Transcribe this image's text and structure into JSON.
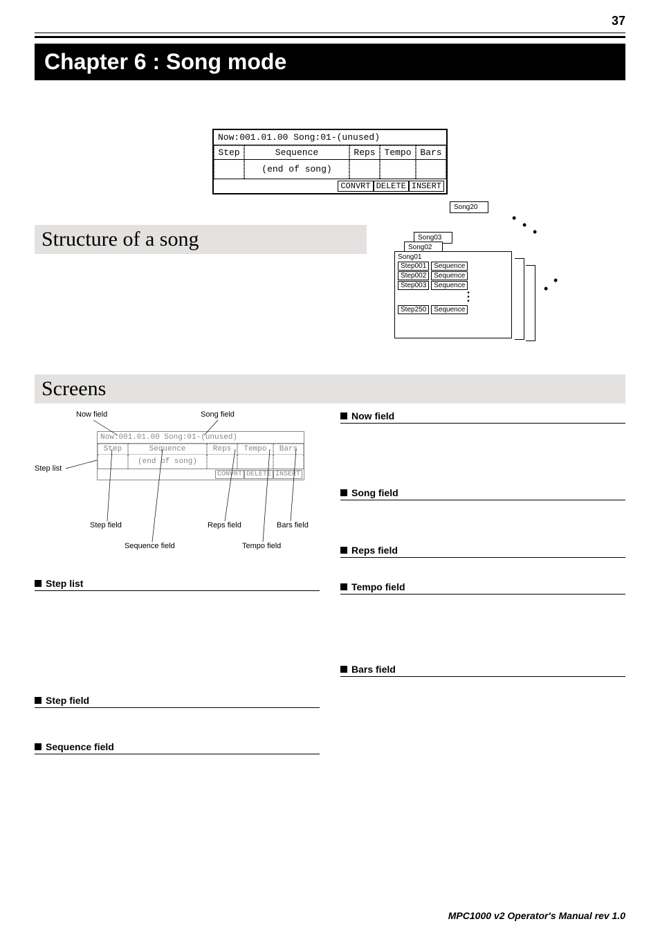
{
  "page_number": "37",
  "chapter_title": "Chapter 6 : Song mode",
  "lcd": {
    "now_line": "Now:001.01.00  Song:01-(unused)",
    "headers": {
      "step": "Step",
      "sequence": "Sequence",
      "reps": "Reps",
      "tempo": "Tempo",
      "bars": "Bars"
    },
    "body_text": "(end of song)",
    "footer": {
      "convert": "CONVRT",
      "delete": "DELETE",
      "insert": "INSERT"
    }
  },
  "sections": {
    "structure": "Structure of a song",
    "screens": "Screens"
  },
  "diagram": {
    "song20": "Song20",
    "song03": "Song03",
    "song02": "Song02",
    "song01": "Song01",
    "step001": "Step001",
    "step002": "Step002",
    "step003": "Step003",
    "step250": "Step250",
    "sequence": "Sequence"
  },
  "labeled": {
    "now": "Now field",
    "song": "Song field",
    "steplist": "Step list",
    "step": "Step field",
    "reps": "Reps field",
    "bars": "Bars field",
    "sequence": "Sequence field",
    "tempo": "Tempo field"
  },
  "mini_lcd": {
    "row1": "Now:001.01.00  Song:01-(unused)",
    "headers": {
      "step": "Step",
      "sequence": "Sequence",
      "reps": "Reps",
      "tempo": "Tempo",
      "bars": "Bars"
    },
    "body": "(end of song)",
    "footer": {
      "convert": "CONVRT",
      "delete": "DELETE",
      "insert": "INSERT"
    }
  },
  "fields": {
    "steplist": "Step list",
    "step": "Step field",
    "sequence": "Sequence field",
    "now": "Now field",
    "song": "Song field",
    "reps": "Reps field",
    "tempo": "Tempo field",
    "bars": "Bars field"
  },
  "footer": "MPC1000 v2 Operator's Manual rev 1.0"
}
